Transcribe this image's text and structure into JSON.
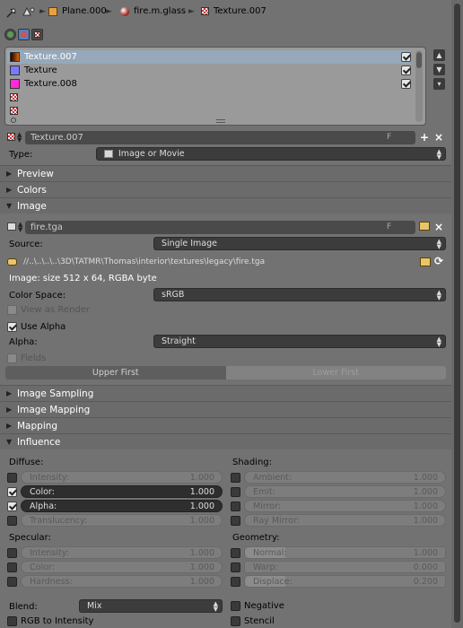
{
  "breadcrumb": {
    "items": [
      "Plane.000",
      "fire.m.glass",
      "Texture.007"
    ]
  },
  "texture_list": {
    "items": [
      {
        "label": "Texture.007",
        "swatch": "#3a1a08",
        "checked": true,
        "selected": true
      },
      {
        "label": "Texture",
        "swatch": "#7a7aff",
        "checked": true,
        "selected": false
      },
      {
        "label": "Texture.008",
        "swatch": "#ff2bd6",
        "checked": true,
        "selected": false
      },
      {
        "label": "",
        "swatch": "checker",
        "checked": false,
        "selected": false
      },
      {
        "label": "",
        "swatch": "checker",
        "checked": false,
        "selected": false
      }
    ]
  },
  "texture_block": {
    "name": "Texture.007",
    "fake_user": "F",
    "add_icon": "+",
    "close_icon": "×"
  },
  "type": {
    "label": "Type:",
    "value": "Image or Movie"
  },
  "panels": {
    "preview": "Preview",
    "colors": "Colors",
    "image": "Image",
    "image_sampling": "Image Sampling",
    "image_mapping": "Image Mapping",
    "mapping": "Mapping",
    "influence": "Influence"
  },
  "image": {
    "name": "fire.tga",
    "fake_user": "F",
    "source_label": "Source:",
    "source_value": "Single Image",
    "path": "//..\\..\\..\\..\\3D\\TATMR\\Thomas\\interior\\textures\\legacy\\fire.tga",
    "info": "Image: size 512 x 64, RGBA byte",
    "color_space_label": "Color Space:",
    "color_space_value": "sRGB",
    "view_as_render": "View as Render",
    "use_alpha": "Use Alpha",
    "alpha_label": "Alpha:",
    "alpha_value": "Straight",
    "fields": "Fields",
    "upper_first": "Upper First",
    "lower_first": "Lower First"
  },
  "influence": {
    "diffuse_label": "Diffuse:",
    "diffuse": [
      {
        "name": "Intensity:",
        "value": "1.000",
        "checked": false,
        "active": false
      },
      {
        "name": "Color:",
        "value": "1.000",
        "checked": true,
        "active": true
      },
      {
        "name": "Alpha:",
        "value": "1.000",
        "checked": true,
        "active": true
      },
      {
        "name": "Translucency:",
        "value": "1.000",
        "checked": false,
        "active": false
      }
    ],
    "shading_label": "Shading:",
    "shading": [
      {
        "name": "Ambient:",
        "value": "1.000"
      },
      {
        "name": "Emit:",
        "value": "1.000"
      },
      {
        "name": "Mirror:",
        "value": "1.000"
      },
      {
        "name": "Ray Mirror:",
        "value": "1.000"
      }
    ],
    "specular_label": "Specular:",
    "specular": [
      {
        "name": "Intensity:",
        "value": "1.000"
      },
      {
        "name": "Color:",
        "value": "1.000"
      },
      {
        "name": "Hardness:",
        "value": "1.000"
      }
    ],
    "geometry_label": "Geometry:",
    "geometry": [
      {
        "name": "Normal:",
        "value": "1.000",
        "fraction": 0.2
      },
      {
        "name": "Warp:",
        "value": "0.000",
        "fraction": 0.0
      },
      {
        "name": "Displace:",
        "value": "0.200",
        "fraction": 0.2
      }
    ],
    "blend_label": "Blend:",
    "blend_value": "Mix",
    "rgb_to_intensity": "RGB to Intensity",
    "negative": "Negative",
    "stencil": "Stencil"
  }
}
